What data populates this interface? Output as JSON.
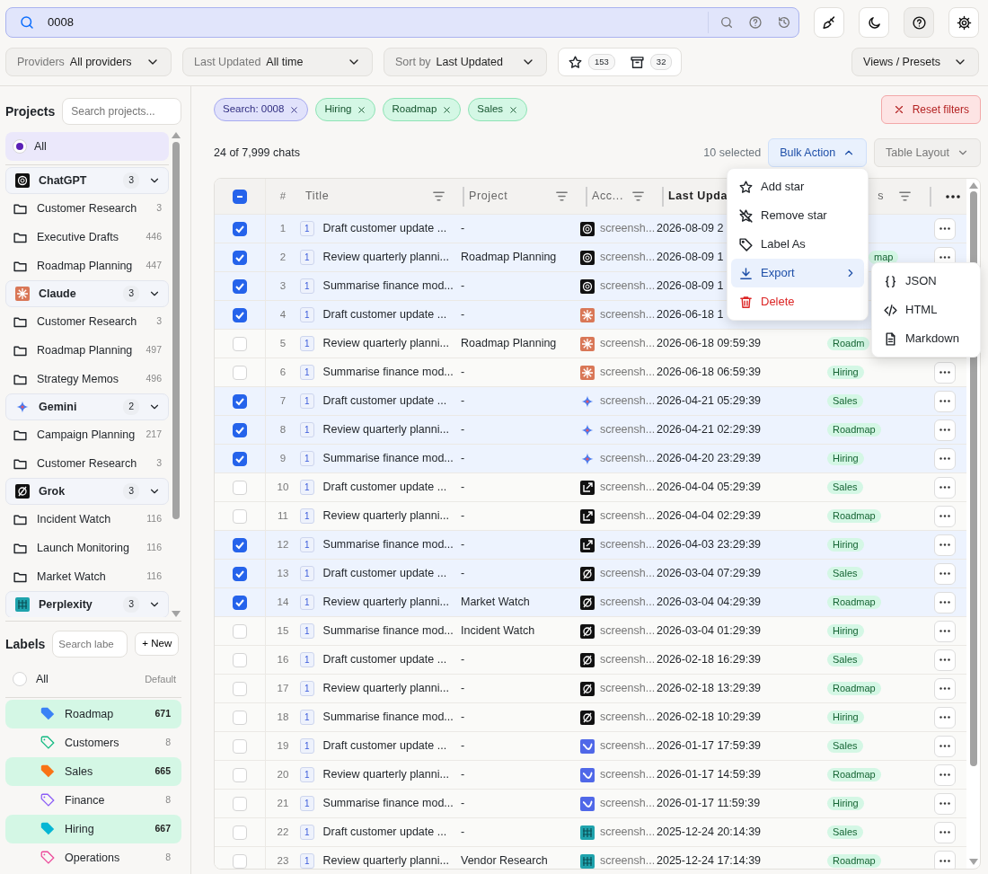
{
  "search": {
    "value": "0008"
  },
  "toolbar_buttons": [
    {
      "kind": "brush",
      "selected": false
    },
    {
      "kind": "moon",
      "selected": false
    },
    {
      "kind": "help",
      "selected": true
    },
    {
      "kind": "gear",
      "selected": false
    }
  ],
  "filters": [
    {
      "label": "Providers",
      "value": "All providers"
    },
    {
      "label": "Last Updated",
      "value": "All time"
    },
    {
      "label": "Sort by",
      "value": "Last Updated"
    }
  ],
  "counters": [
    {
      "kind": "star",
      "count": "153"
    },
    {
      "kind": "archive",
      "count": "32"
    }
  ],
  "views_button": "Views / Presets",
  "sidebar": {
    "projects_title": "Projects",
    "projects_search_placeholder": "Search projects...",
    "all_projects": {
      "label": "All",
      "selected": true
    },
    "groups": [
      {
        "name": "ChatGPT",
        "logo": {
          "kind": "knot"
        },
        "count": "3",
        "expanded": true,
        "folders": [
          {
            "name": "Customer Research",
            "count": "3"
          },
          {
            "name": "Executive Drafts",
            "count": "446"
          },
          {
            "name": "Roadmap Planning",
            "count": "447"
          }
        ]
      },
      {
        "name": "Claude",
        "logo": {
          "kind": "burst"
        },
        "count": "3",
        "expanded": true,
        "folders": [
          {
            "name": "Customer Research",
            "count": "3"
          },
          {
            "name": "Roadmap Planning",
            "count": "497"
          },
          {
            "name": "Strategy Memos",
            "count": "496"
          }
        ]
      },
      {
        "name": "Gemini",
        "logo": {
          "kind": "sparkle"
        },
        "count": "2",
        "expanded": true,
        "folders": [
          {
            "name": "Campaign Planning",
            "count": "217"
          },
          {
            "name": "Customer Research",
            "count": "3"
          }
        ]
      },
      {
        "name": "Grok",
        "logo": {
          "kind": "slash"
        },
        "count": "3",
        "expanded": true,
        "folders": [
          {
            "name": "Incident Watch",
            "count": "116"
          },
          {
            "name": "Launch Monitoring",
            "count": "116"
          },
          {
            "name": "Market Watch",
            "count": "116"
          }
        ]
      },
      {
        "name": "Perplexity",
        "logo": {
          "kind": "grid"
        },
        "count": "3",
        "expanded": true
      }
    ],
    "labels_title": "Labels",
    "labels_search_placeholder": "Search labe",
    "new_button": "+ New",
    "all_labels": {
      "label": "All",
      "selected": false,
      "note": "Default"
    },
    "labels": [
      {
        "name": "Roadmap",
        "count": "671",
        "color": "#3b82f6",
        "selected": true
      },
      {
        "name": "Customers",
        "count": "8",
        "color": "#10b981",
        "selected": false
      },
      {
        "name": "Sales",
        "count": "665",
        "color": "#f97316",
        "selected": true
      },
      {
        "name": "Finance",
        "count": "8",
        "color": "#8b5cf6",
        "selected": false
      },
      {
        "name": "Hiring",
        "count": "667",
        "color": "#06b6d4",
        "selected": true
      },
      {
        "name": "Operations",
        "count": "8",
        "color": "#ec4899",
        "selected": false
      }
    ]
  },
  "chips": [
    {
      "kind": "search",
      "label": "Search: 0008"
    },
    {
      "kind": "label",
      "label": "Hiring"
    },
    {
      "kind": "label",
      "label": "Roadmap"
    },
    {
      "kind": "label",
      "label": "Sales"
    }
  ],
  "reset_button": "Reset filters",
  "result_count": "24 of 7,999 chats",
  "selected_count": "10 selected",
  "bulk_button": {
    "label": "Bulk Action",
    "expanded": true
  },
  "layout_button": "Table Layout",
  "table": {
    "select_all": {
      "checked": true,
      "partial": true
    },
    "columns": [
      {
        "label": "#"
      },
      {
        "label": "Title",
        "filter": true
      },
      {
        "label": "Project",
        "filter": true
      },
      {
        "label": "Acc...",
        "filter": true
      },
      {
        "label": "Last Upda",
        "filter": false
      },
      {
        "label": "s",
        "filter": true
      }
    ],
    "rows": [
      {
        "number": "1",
        "selected": true,
        "messages": "1",
        "title": "Draft customer update ...",
        "project": "-",
        "account": "screensh...",
        "logo": {
          "kind": "knot"
        },
        "updated": "2026-08-09 2",
        "more": true
      },
      {
        "number": "2",
        "selected": true,
        "messages": "1",
        "title": "Review quarterly planni...",
        "project": "Roadmap Planning",
        "account": "screensh...",
        "logo": {
          "kind": "knot"
        },
        "updated": "2026-08-09 1",
        "label": "map",
        "more": true
      },
      {
        "number": "3",
        "selected": true,
        "messages": "1",
        "title": "Summarise finance mod...",
        "project": "-",
        "account": "screensh...",
        "logo": {
          "kind": "knot"
        },
        "updated": "2026-08-09 1",
        "more": false
      },
      {
        "number": "4",
        "selected": true,
        "messages": "1",
        "title": "Draft customer update ...",
        "project": "-",
        "account": "screensh...",
        "logo": {
          "kind": "burst"
        },
        "updated": "2026-06-18 1",
        "more": false
      },
      {
        "number": "5",
        "selected": false,
        "messages": "1",
        "title": "Review quarterly planni...",
        "project": "Roadmap Planning",
        "account": "screensh...",
        "logo": {
          "kind": "burst"
        },
        "updated": "2026-06-18 09:59:39",
        "label": "Roadm",
        "more": false
      },
      {
        "number": "6",
        "selected": false,
        "messages": "1",
        "title": "Summarise finance mod...",
        "project": "-",
        "account": "screensh...",
        "logo": {
          "kind": "burst"
        },
        "updated": "2026-06-18 06:59:39",
        "label": "Hiring",
        "more": true
      },
      {
        "number": "7",
        "selected": true,
        "messages": "1",
        "title": "Draft customer update ...",
        "project": "-",
        "account": "screensh...",
        "logo": {
          "kind": "sparkle"
        },
        "updated": "2026-04-21 05:29:39",
        "label": "Sales",
        "more": true
      },
      {
        "number": "8",
        "selected": true,
        "messages": "1",
        "title": "Review quarterly planni...",
        "project": "-",
        "account": "screensh...",
        "logo": {
          "kind": "sparkle"
        },
        "updated": "2026-04-21 02:29:39",
        "label": "Roadmap",
        "more": true
      },
      {
        "number": "9",
        "selected": true,
        "messages": "1",
        "title": "Summarise finance mod...",
        "project": "-",
        "account": "screensh...",
        "logo": {
          "kind": "sparkle"
        },
        "updated": "2026-04-20 23:29:39",
        "label": "Hiring",
        "more": true
      },
      {
        "number": "10",
        "selected": false,
        "messages": "1",
        "title": "Draft customer update ...",
        "project": "-",
        "account": "screensh...",
        "logo": {
          "kind": "arrow"
        },
        "updated": "2026-04-04 05:29:39",
        "label": "Sales",
        "more": true
      },
      {
        "number": "11",
        "selected": false,
        "messages": "1",
        "title": "Review quarterly planni...",
        "project": "-",
        "account": "screensh...",
        "logo": {
          "kind": "arrow"
        },
        "updated": "2026-04-04 02:29:39",
        "label": "Roadmap",
        "more": true
      },
      {
        "number": "12",
        "selected": true,
        "messages": "1",
        "title": "Summarise finance mod...",
        "project": "-",
        "account": "screensh...",
        "logo": {
          "kind": "arrow"
        },
        "updated": "2026-04-03 23:29:39",
        "label": "Hiring",
        "more": true
      },
      {
        "number": "13",
        "selected": true,
        "messages": "1",
        "title": "Draft customer update ...",
        "project": "-",
        "account": "screensh...",
        "logo": {
          "kind": "slash"
        },
        "updated": "2026-03-04 07:29:39",
        "label": "Sales",
        "more": true
      },
      {
        "number": "14",
        "selected": true,
        "messages": "1",
        "title": "Review quarterly planni...",
        "project": "Market Watch",
        "account": "screensh...",
        "logo": {
          "kind": "slash"
        },
        "updated": "2026-03-04 04:29:39",
        "label": "Roadmap",
        "more": true
      },
      {
        "number": "15",
        "selected": false,
        "messages": "1",
        "title": "Summarise finance mod...",
        "project": "Incident Watch",
        "account": "screensh...",
        "logo": {
          "kind": "slash"
        },
        "updated": "2026-03-04 01:29:39",
        "label": "Hiring",
        "more": true
      },
      {
        "number": "16",
        "selected": false,
        "messages": "1",
        "title": "Draft customer update ...",
        "project": "-",
        "account": "screensh...",
        "logo": {
          "kind": "slash"
        },
        "updated": "2026-02-18 16:29:39",
        "label": "Sales",
        "more": true
      },
      {
        "number": "17",
        "selected": false,
        "messages": "1",
        "title": "Review quarterly planni...",
        "project": "-",
        "account": "screensh...",
        "logo": {
          "kind": "slash"
        },
        "updated": "2026-02-18 13:29:39",
        "label": "Roadmap",
        "more": true
      },
      {
        "number": "18",
        "selected": false,
        "messages": "1",
        "title": "Summarise finance mod...",
        "project": "-",
        "account": "screensh...",
        "logo": {
          "kind": "slash"
        },
        "updated": "2026-02-18 10:29:39",
        "label": "Hiring",
        "more": true
      },
      {
        "number": "19",
        "selected": false,
        "messages": "1",
        "title": "Draft customer update ...",
        "project": "-",
        "account": "screensh...",
        "logo": {
          "kind": "wave"
        },
        "updated": "2026-01-17 17:59:39",
        "label": "Sales",
        "more": true
      },
      {
        "number": "20",
        "selected": false,
        "messages": "1",
        "title": "Review quarterly planni...",
        "project": "-",
        "account": "screensh...",
        "logo": {
          "kind": "wave"
        },
        "updated": "2026-01-17 14:59:39",
        "label": "Roadmap",
        "more": true
      },
      {
        "number": "21",
        "selected": false,
        "messages": "1",
        "title": "Summarise finance mod...",
        "project": "-",
        "account": "screensh...",
        "logo": {
          "kind": "wave"
        },
        "updated": "2026-01-17 11:59:39",
        "label": "Hiring",
        "more": true
      },
      {
        "number": "22",
        "selected": false,
        "messages": "1",
        "title": "Draft customer update ...",
        "project": "-",
        "account": "screensh...",
        "logo": {
          "kind": "grid"
        },
        "updated": "2025-12-24 20:14:39",
        "label": "Sales",
        "more": true
      },
      {
        "number": "23",
        "selected": false,
        "messages": "1",
        "title": "Review quarterly planni...",
        "project": "Vendor Research",
        "account": "screensh...",
        "logo": {
          "kind": "grid"
        },
        "updated": "2025-12-24 17:14:39",
        "label": "Roadmap",
        "more": true
      }
    ]
  },
  "bulk_menu": {
    "items": [
      {
        "kind": "star",
        "label": "Add star",
        "selected": false
      },
      {
        "kind": "star-off",
        "label": "Remove star",
        "selected": false
      },
      {
        "kind": "tag",
        "label": "Label As",
        "selected": false
      },
      {
        "kind": "download",
        "label": "Export",
        "selected": true
      },
      {
        "kind": "trash",
        "label": "Delete",
        "selected": false
      }
    ],
    "submenu": [
      {
        "kind": "braces",
        "label": "JSON"
      },
      {
        "kind": "code",
        "label": "HTML"
      },
      {
        "kind": "file",
        "label": "Markdown"
      }
    ]
  }
}
